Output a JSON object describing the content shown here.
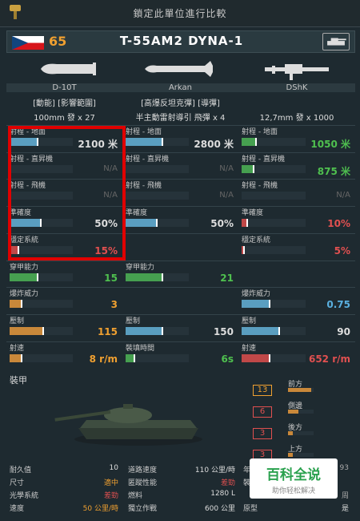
{
  "topbar": {
    "title": "鎖定此單位進行比較"
  },
  "header": {
    "rank": "65",
    "vehicle_name": "T-55AM2 DYNA-1",
    "flag": "czech-flag",
    "icon": "tank-icon"
  },
  "weapons": [
    {
      "name": "D-10T",
      "type": "[動能] [影響範圍]",
      "ammo_prefix": "100mm 發",
      "ammo_count": "x 27"
    },
    {
      "name": "Arkan",
      "type": "[高爆反坦克彈] [導彈]",
      "ammo_prefix": "半主動雷射導引 飛彈",
      "ammo_count": "x 4"
    },
    {
      "name": "DShK",
      "type": "",
      "ammo_prefix": "12,7mm 發",
      "ammo_count": "x 1000"
    }
  ],
  "stats": [
    {
      "label": "射程 - 地面",
      "cols": [
        {
          "value": "2100 米",
          "fill": 0.46,
          "color": "#5a9ec0",
          "vcolor": "#ddd"
        },
        {
          "value": "2800 米",
          "fill": 0.6,
          "color": "#5a9ec0",
          "vcolor": "#ddd"
        },
        {
          "value": "1050 米",
          "fill": 0.24,
          "color": "#46a050",
          "vcolor": "#4fc04f"
        }
      ]
    },
    {
      "label": "射程 - 直昇機",
      "cols": [
        {
          "value": "N/A",
          "fill": 0,
          "color": "#5a9ec0",
          "vcolor": "#666"
        },
        {
          "value": "N/A",
          "fill": 0,
          "color": "#5a9ec0",
          "vcolor": "#666"
        },
        {
          "value": "875 米",
          "fill": 0.2,
          "color": "#46a050",
          "vcolor": "#4fc04f"
        }
      ]
    },
    {
      "label": "射程 - 飛機",
      "cols": [
        {
          "value": "N/A",
          "fill": 0,
          "color": "#5a9ec0",
          "vcolor": "#666"
        },
        {
          "value": "N/A",
          "fill": 0,
          "color": "#5a9ec0",
          "vcolor": "#666"
        },
        {
          "value": "N/A",
          "fill": 0,
          "color": "#5a9ec0",
          "vcolor": "#666"
        }
      ]
    },
    {
      "label": "準確度",
      "cols": [
        {
          "value": "50%",
          "fill": 0.5,
          "color": "#5a9ec0",
          "vcolor": "#ddd"
        },
        {
          "value": "50%",
          "fill": 0.5,
          "color": "#5a9ec0",
          "vcolor": "#ddd"
        },
        {
          "value": "10%",
          "fill": 0.1,
          "color": "#c04848",
          "vcolor": "#e05050"
        }
      ]
    },
    {
      "label": "穩定系統",
      "cols": [
        {
          "value": "15%",
          "fill": 0.15,
          "color": "#c04848",
          "vcolor": "#e05050"
        },
        {
          "value": "",
          "fill": 0,
          "color": "#5a9ec0",
          "vcolor": "#ddd"
        },
        {
          "value": "5%",
          "fill": 0.05,
          "color": "#c04848",
          "vcolor": "#e05050"
        }
      ]
    },
    {
      "label": "穿甲能力",
      "cols": [
        {
          "value": "15",
          "fill": 0.45,
          "color": "#46a050",
          "vcolor": "#4fc04f"
        },
        {
          "value": "21",
          "fill": 0.6,
          "color": "#46a050",
          "vcolor": "#4fc04f"
        },
        {
          "value": "",
          "fill": 0,
          "color": "#5a9ec0",
          "vcolor": "#ddd"
        }
      ]
    },
    {
      "label": "爆炸威力",
      "cols": [
        {
          "value": "3",
          "fill": 0.2,
          "color": "#c9883a",
          "vcolor": "#f0a030"
        },
        {
          "value": "",
          "fill": 0,
          "color": "#5a9ec0",
          "vcolor": "#ddd"
        },
        {
          "value": "0.75",
          "fill": 0.45,
          "color": "#5a9ec0",
          "vcolor": "#5ab0e0"
        }
      ]
    },
    {
      "label": "壓制",
      "cols": [
        {
          "value": "115",
          "fill": 0.55,
          "color": "#c9883a",
          "vcolor": "#f0a030"
        },
        {
          "value": "150",
          "fill": 0.6,
          "color": "#5a9ec0",
          "vcolor": "#ddd"
        },
        {
          "value": "90",
          "fill": 0.6,
          "color": "#5a9ec0",
          "vcolor": "#ddd"
        }
      ]
    },
    {
      "label": "射速",
      "cols": [
        {
          "value": "8 r/m",
          "fill": 0.2,
          "color": "#c9883a",
          "vcolor": "#f0a030"
        },
        {
          "value": "6s",
          "fill": 0.15,
          "color": "#46a050",
          "vcolor": "#4fc04f"
        },
        {
          "value": "652 r/m",
          "fill": 0.45,
          "color": "#c04848",
          "vcolor": "#e05050"
        }
      ]
    }
  ],
  "stat_second_labels": {
    "col1_row8": "裝填時間"
  },
  "armor": {
    "title": "裝甲",
    "sides": [
      {
        "label": "前方",
        "value": "13",
        "fill": 0.9,
        "box_color": "#f0a030"
      },
      {
        "label": "側邊",
        "value": "6",
        "fill": 0.4,
        "box_color": "#e05050"
      },
      {
        "label": "後方",
        "value": "3",
        "fill": 0.2,
        "box_color": "#e05050"
      },
      {
        "label": "上方",
        "value": "3",
        "fill": 0.2,
        "box_color": "#e05050"
      }
    ]
  },
  "bottom": [
    [
      {
        "label": "耐久值",
        "value": "10",
        "vcolor": "#ddd"
      },
      {
        "label": "道路速度",
        "value": "110 公里/時",
        "vcolor": "#ddd"
      },
      {
        "label": "年",
        "value": "93",
        "vcolor": "#aaa"
      }
    ],
    [
      {
        "label": "尺寸",
        "value": "適中",
        "vcolor": "#f0a030"
      },
      {
        "label": "匿蹤性能",
        "value": "差勁",
        "vcolor": "#e05050"
      },
      {
        "label": "裝",
        "value": "",
        "vcolor": "#aaa"
      }
    ],
    [
      {
        "label": "光學系統",
        "value": "差勁",
        "vcolor": "#e05050"
      },
      {
        "label": "燃料",
        "value": "1280 L",
        "vcolor": "#ddd"
      },
      {
        "label": "",
        "value": "周",
        "vcolor": "#aaa"
      }
    ],
    [
      {
        "label": "速度",
        "value": "50 公里/時",
        "vcolor": "#f0a030"
      },
      {
        "label": "獨立作戰",
        "value": "600 公里",
        "vcolor": "#ddd"
      },
      {
        "label": "原型",
        "value": "是",
        "vcolor": "#ddd"
      }
    ]
  ],
  "watermark": {
    "line1": "百科全说",
    "line2": "助你轻松解决"
  }
}
